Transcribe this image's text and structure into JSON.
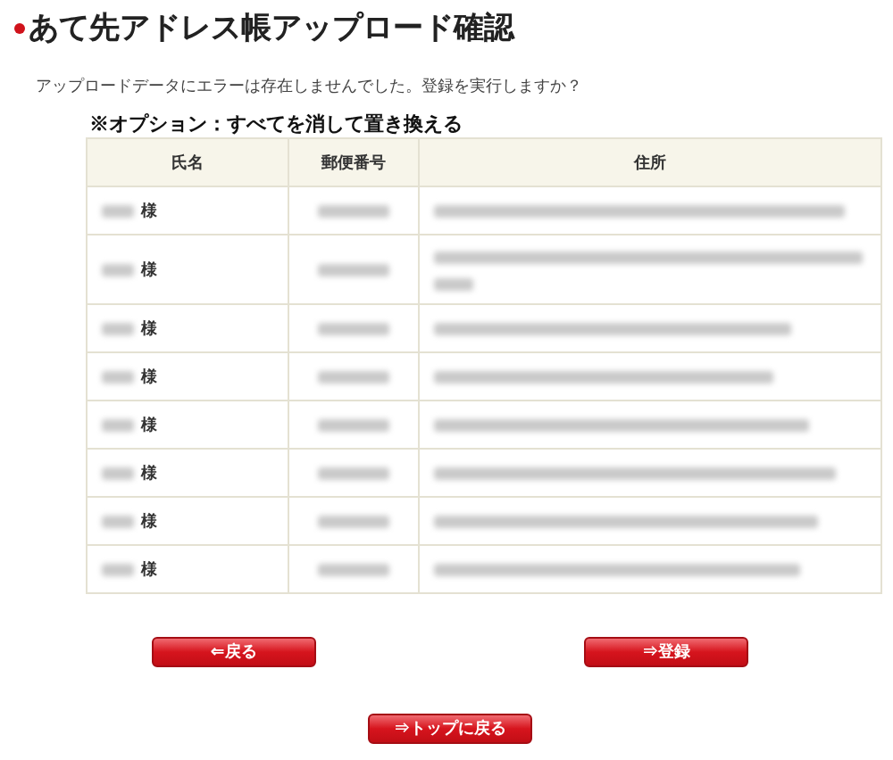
{
  "page_title": "あて先アドレス帳アップロード確認",
  "message": "アップロードデータにエラーは存在しませんでした。登録を実行しますか？",
  "option_heading": "※オプション：すべてを消して置き換える",
  "table": {
    "columns": [
      "氏名",
      "郵便番号",
      "住所"
    ],
    "rows": [
      {
        "honorific": "様",
        "address_wrapped": false
      },
      {
        "honorific": "様",
        "address_wrapped": true
      },
      {
        "honorific": "様",
        "address_wrapped": false
      },
      {
        "honorific": "様",
        "address_wrapped": false
      },
      {
        "honorific": "様",
        "address_wrapped": false
      },
      {
        "honorific": "様",
        "address_wrapped": false
      },
      {
        "honorific": "様",
        "address_wrapped": false
      },
      {
        "honorific": "様",
        "address_wrapped": false
      }
    ]
  },
  "buttons": {
    "back": "⇐戻る",
    "register": "⇒登録",
    "top": "⇒トップに戻る"
  }
}
